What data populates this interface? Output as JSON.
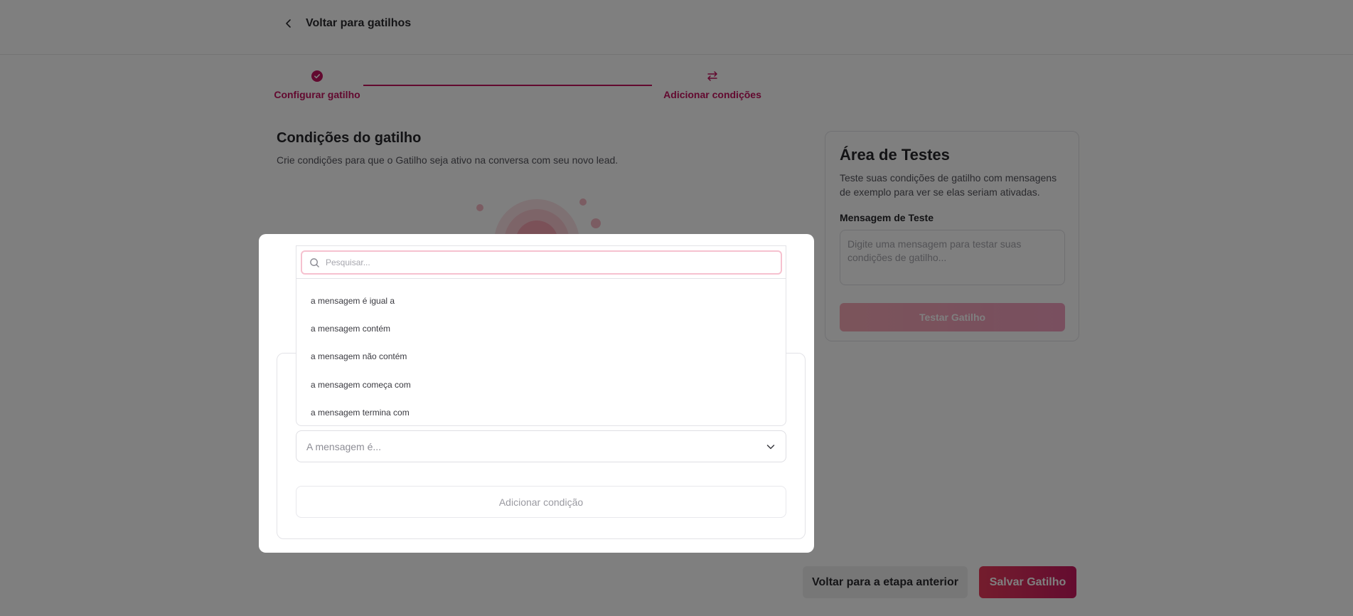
{
  "header": {
    "back_label": "Voltar para gatilhos"
  },
  "stepper": {
    "steps": [
      {
        "label": "Configurar gatilho",
        "state": "completed",
        "icon": "check-circle-icon"
      },
      {
        "label": "Adicionar condições",
        "state": "active",
        "icon": "swap-arrows-icon"
      }
    ]
  },
  "conditions": {
    "title": "Condições do gatilho",
    "subtitle": "Crie condições para que o Gatilho seja ativo na conversa com seu novo lead."
  },
  "test_area": {
    "title": "Área de Testes",
    "description": "Teste suas condições de gatilho com mensagens de exemplo para ver se elas seriam ativadas.",
    "message_label": "Mensagem de Teste",
    "message_placeholder": "Digite uma mensagem para testar suas condições de gatilho...",
    "test_button": "Testar Gatilho"
  },
  "footer": {
    "back_button": "Voltar para a etapa anterior",
    "save_button": "Salvar Gatilho"
  },
  "modal": {
    "select_placeholder": "A mensagem é...",
    "add_condition": "Adicionar condição",
    "dropdown": {
      "search_placeholder": "Pesquisar...",
      "options": [
        "a mensagem é igual a",
        "a mensagem contém",
        "a mensagem não contém",
        "a mensagem começa com",
        "a mensagem termina com"
      ]
    }
  },
  "colors": {
    "brand": "#c4125f",
    "save_gradient_start": "#e83a5a",
    "save_gradient_end": "#c8185f",
    "overlay": "rgba(0,0,0,0.5)"
  }
}
